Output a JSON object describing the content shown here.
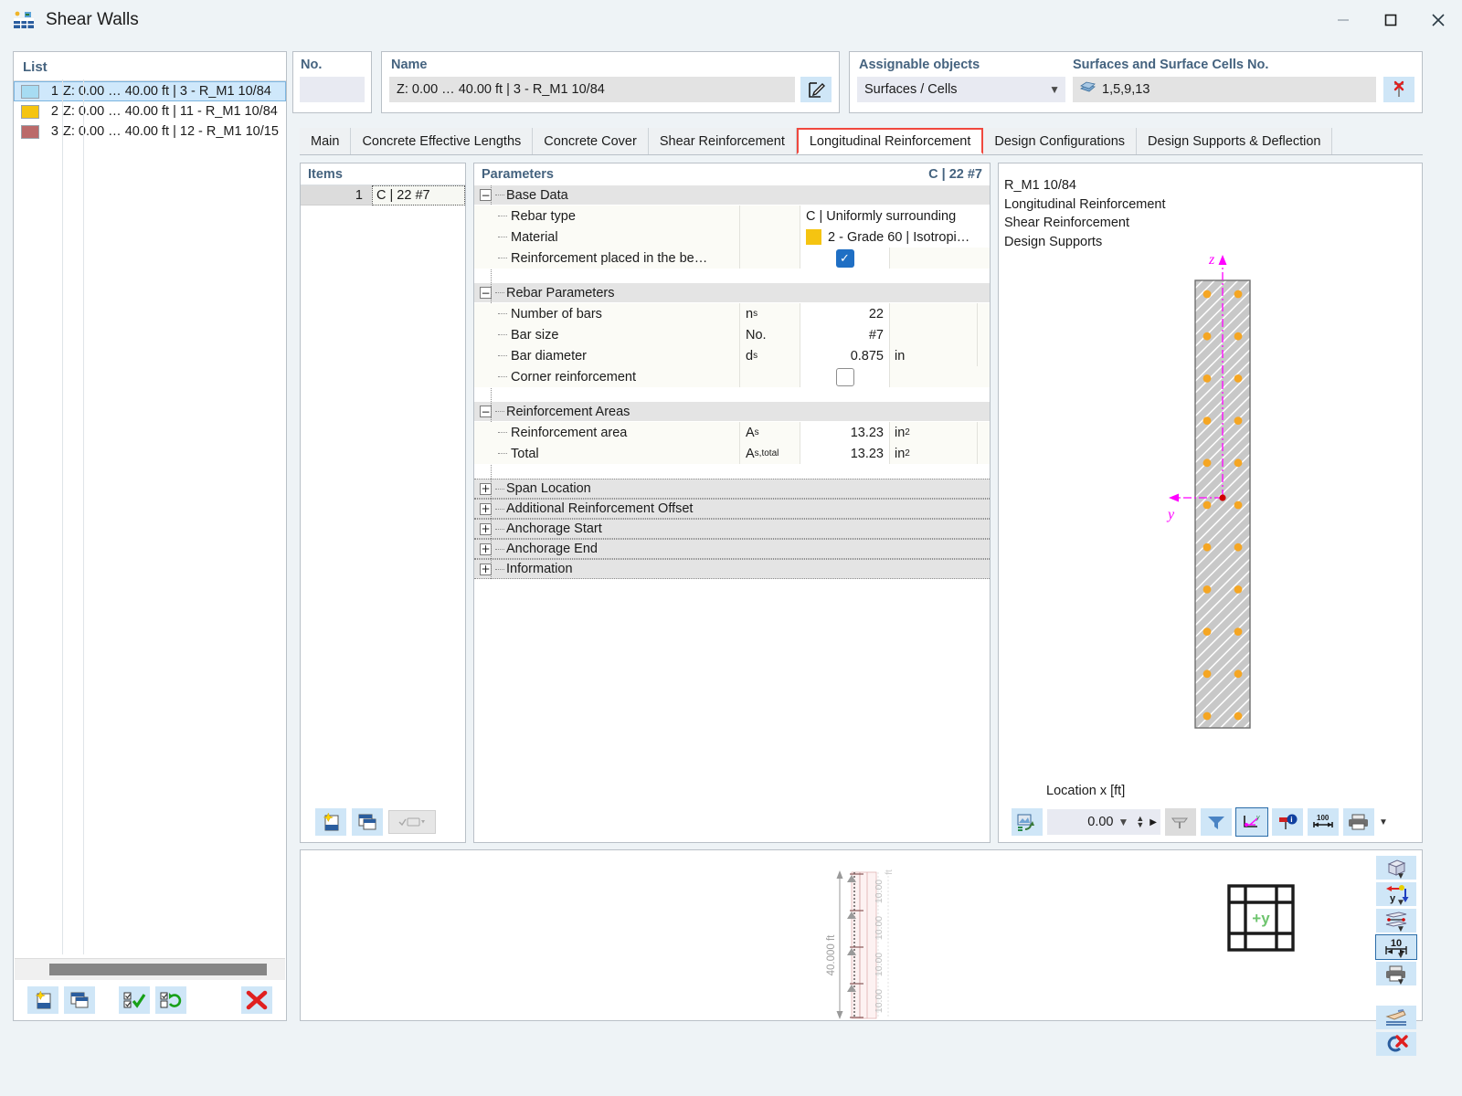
{
  "window": {
    "title": "Shear Walls",
    "icon": "shear-walls-icon",
    "minimize": "—",
    "maximize": "□",
    "close": "✕"
  },
  "list": {
    "header": "List",
    "rows": [
      {
        "num": "1",
        "text": "Z: 0.00 … 40.00 ft | 3 - R_M1 10/84",
        "color": "#a7dcf2",
        "selected": true
      },
      {
        "num": "2",
        "text": "Z: 0.00 … 40.00 ft | 11 - R_M1 10/84",
        "color": "#f5c411",
        "selected": false
      },
      {
        "num": "3",
        "text": "Z: 0.00 … 40.00 ft | 12 - R_M1 10/15",
        "color": "#bb6a6a",
        "selected": false
      }
    ],
    "toolbar": [
      {
        "name": "new-item-button",
        "icon": "new-document-star-icon"
      },
      {
        "name": "copy-item-button",
        "icon": "copy-window-icon"
      },
      {
        "name": "select-all-button",
        "icon": "check-all-icon"
      },
      {
        "name": "invert-selection-button",
        "icon": "invert-selection-icon"
      },
      {
        "name": "delete-button",
        "icon": "red-x-icon"
      }
    ]
  },
  "fields": {
    "no_label": "No.",
    "no_value": "",
    "name_label": "Name",
    "name_value": "Z: 0.00 … 40.00  ft | 3 - R_M1 10/84",
    "name_edit_icon": "edit-pencil-icon",
    "assignable_label": "Assignable objects",
    "assignable_value": "Surfaces / Cells",
    "surfaces_label": "Surfaces and Surface Cells No.",
    "surfaces_value": "1,5,9,13",
    "surfaces_icon": "surfaces-icon",
    "pick_icon": "pick-cancel-icon"
  },
  "tabs": [
    {
      "label": "Main",
      "active": false
    },
    {
      "label": "Concrete Effective Lengths",
      "active": false
    },
    {
      "label": "Concrete Cover",
      "active": false
    },
    {
      "label": "Shear Reinforcement",
      "active": false
    },
    {
      "label": "Longitudinal Reinforcement",
      "active": true
    },
    {
      "label": "Design Configurations",
      "active": false
    },
    {
      "label": "Design Supports & Deflection",
      "active": false
    }
  ],
  "items": {
    "header": "Items",
    "rows": [
      {
        "num": "1",
        "value": "C | 22 #7"
      }
    ],
    "toolbar": [
      {
        "name": "new-item-button",
        "icon": "new-document-star-icon"
      },
      {
        "name": "copy-item-button",
        "icon": "copy-window-icon"
      },
      {
        "name": "item-dropdown-button",
        "icon": "select-dropdown-icon"
      }
    ]
  },
  "parameters": {
    "header": "Parameters",
    "header_right": "C | 22 #7",
    "groups": [
      {
        "name": "Base Data",
        "expanded": true,
        "rows": [
          {
            "label": "Rebar type",
            "symbol": "",
            "value": "C | Uniformly surrounding",
            "kind": "wide"
          },
          {
            "label": "Material",
            "symbol": "",
            "value": "2 - Grade 60 | Isotropi…",
            "kind": "wide",
            "swatch": "#f5c411"
          },
          {
            "label": "Reinforcement placed in the be…",
            "symbol": "",
            "value": "",
            "kind": "check",
            "checked": true
          }
        ]
      },
      {
        "name": "Rebar Parameters",
        "expanded": true,
        "rows": [
          {
            "label": "Number of bars",
            "symbol": "n",
            "sub": "s",
            "value": "22",
            "unit": ""
          },
          {
            "label": "Bar size",
            "symbol": "No.",
            "sub": "",
            "value": "#7",
            "unit": ""
          },
          {
            "label": "Bar diameter",
            "symbol": "d",
            "sub": "s",
            "value": "0.875",
            "unit": "in"
          },
          {
            "label": "Corner reinforcement",
            "symbol": "",
            "sub": "",
            "value": "",
            "kind": "check",
            "checked": false
          }
        ]
      },
      {
        "name": "Reinforcement Areas",
        "expanded": true,
        "rows": [
          {
            "label": "Reinforcement area",
            "symbol": "A",
            "sub": "s",
            "value": "13.23",
            "unit": "in",
            "unit_sup": "2"
          },
          {
            "label": "Total",
            "symbol": "A",
            "sub": "s,total",
            "value": "13.23",
            "unit": "in",
            "unit_sup": "2"
          }
        ]
      }
    ],
    "collapsed_groups": [
      "Span Location",
      "Additional Reinforcement Offset",
      "Anchorage Start",
      "Anchorage End",
      "Information"
    ]
  },
  "result_panel": {
    "lines": [
      "R_M1 10/84",
      "Longitudinal Reinforcement",
      "Shear Reinforcement",
      "Design Supports"
    ],
    "axis_z": "z",
    "axis_y": "y",
    "location_label": "Location x [ft]",
    "location_value": "0.00",
    "toolbar": [
      {
        "name": "export-image-button",
        "icon": "export-picture-icon"
      },
      {
        "name": "section-view-button",
        "icon": "section-cut-icon"
      },
      {
        "name": "filter-button",
        "icon": "funnel-icon"
      },
      {
        "name": "axis-system-button",
        "icon": "local-axes-icon"
      },
      {
        "name": "info-button",
        "icon": "info-pin-icon"
      },
      {
        "name": "dimensions-button",
        "icon": "dimension-100-icon"
      },
      {
        "name": "print-button",
        "icon": "printer-icon"
      }
    ]
  },
  "view3d": {
    "dim_total": "40.000 ft",
    "dim_segments": [
      "10.00",
      "10.00",
      "10.00",
      "10.00"
    ],
    "dim_unit": "ft",
    "axis_label": "+y",
    "toolbar": [
      {
        "name": "isometric-view-button",
        "icon": "cube-icon",
        "selected": false
      },
      {
        "name": "view-direction-button",
        "icon": "y-axis-arrows-icon",
        "selected": false
      },
      {
        "name": "section-plane-button",
        "icon": "slab-section-icon",
        "selected": false
      },
      {
        "name": "scale-button",
        "icon": "scale-10-icon",
        "selected": true,
        "code": "10"
      },
      {
        "name": "print-view-button",
        "icon": "printer-icon",
        "selected": false
      },
      {
        "name": "pointer-tool-button",
        "icon": "hand-pointer-icon",
        "selected": false
      },
      {
        "name": "close-view-button",
        "icon": "close-red-x-icon",
        "selected": false
      }
    ]
  },
  "colors": {
    "accent_blue": "#45637f",
    "tab_highlight": "#f0483e",
    "selection": "#cfe8fb",
    "rebar": "#f5a623",
    "axis_magenta": "#ff00ff",
    "check_blue": "#1f6fc4"
  },
  "section_drawing": {
    "rows": 11,
    "columns": 2,
    "bar_count": 22,
    "fill": "#c8c8c8",
    "hatch": "diagonal"
  }
}
